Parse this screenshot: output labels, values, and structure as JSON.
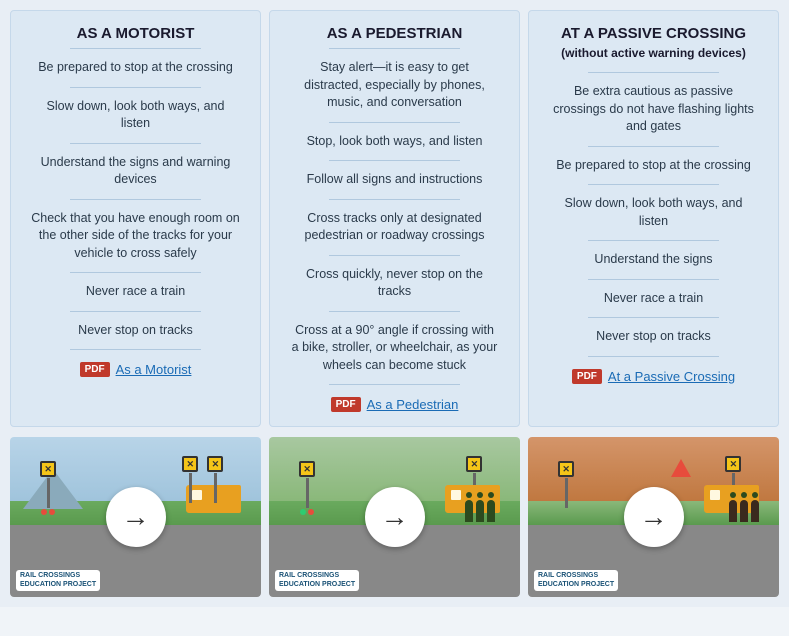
{
  "cards": [
    {
      "id": "motorist",
      "title": "AS A MOTORIST",
      "subtitle": null,
      "items": [
        "Be prepared to stop at the crossing",
        "Slow down, look both ways, and listen",
        "Understand the signs and warning devices",
        "Check that you have enough room on the other side of the tracks for your vehicle to cross safely",
        "Never race a train",
        "Never stop on tracks"
      ],
      "pdf_label": "As a Motorist"
    },
    {
      "id": "pedestrian",
      "title": "AS A PEDESTRIAN",
      "subtitle": null,
      "items": [
        "Stay alert—it is easy to get distracted, especially by phones, music, and conversation",
        "Stop, look both ways, and listen",
        "Follow all signs and instructions",
        "Cross tracks only at designated pedestrian or roadway crossings",
        "Cross quickly, never stop on the tracks",
        "Cross at a 90° angle if crossing with a bike, stroller, or wheelchair, as your wheels can become stuck"
      ],
      "pdf_label": "As a Pedestrian"
    },
    {
      "id": "passive",
      "title": "AT A PASSIVE CROSSING",
      "subtitle": "(without active warning devices)",
      "items": [
        "Be extra cautious as passive crossings do not have flashing lights and gates",
        "Be prepared to stop at the crossing",
        "Slow down, look both ways, and listen",
        "Understand the signs",
        "Never race a train",
        "Never stop on tracks"
      ],
      "pdf_label": "At a Passive Crossing"
    }
  ],
  "images": [
    {
      "id": "img-motorist",
      "alt": "Motorist crossing scene"
    },
    {
      "id": "img-pedestrian",
      "alt": "Pedestrian crossing scene"
    },
    {
      "id": "img-passive",
      "alt": "Passive crossing scene"
    }
  ],
  "pdf_badge_label": "PDF",
  "arrow_symbol": "→",
  "logo_line1": "RAIL CROSSINGS",
  "logo_line2": "EDUCATION PROJECT"
}
